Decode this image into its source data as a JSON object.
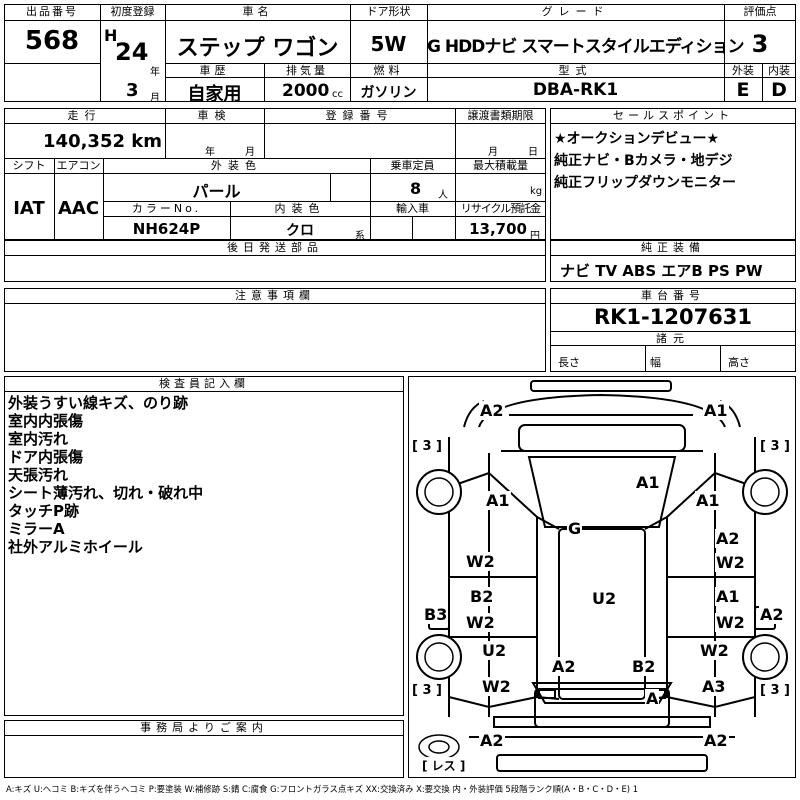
{
  "header": {
    "lot_label": "出品番号",
    "lot": "568",
    "first_reg_label": "初度登録",
    "era": "H",
    "year_num": "24",
    "year_unit": "年",
    "month_num": "3",
    "month_unit": "月",
    "name_label": "車名",
    "name": "ステップ ワゴン",
    "door_label": "ドア形状",
    "door": "5W",
    "grade_label": "グレード",
    "grade": "G HDDナビ スマートスタイルエディション",
    "score_label": "評価点",
    "score": "3",
    "history_label": "車歴",
    "history": "自家用",
    "displacement_label": "排気量",
    "displacement": "2000",
    "displacement_unit": "cc",
    "fuel_label": "燃料",
    "fuel": "ガソリン",
    "model_label": "型式",
    "model": "DBA-RK1",
    "ext_grade_label": "外装",
    "ext_grade": "E",
    "int_grade_label": "内装",
    "int_grade": "D"
  },
  "row2": {
    "mileage_label": "走行",
    "mileage": "140,352 km",
    "inspection_label": "車検",
    "year_unit": "年",
    "month_unit": "月",
    "plate_label": "登録番号",
    "transfer_label": "譲渡書類期限",
    "transfer_month": "月",
    "transfer_day": "日",
    "shift_label": "シフト",
    "shift": "IAT",
    "ac_label": "エアコン",
    "ac": "AAC",
    "exterior_label": "外装色",
    "exterior": "パール",
    "capacity_label": "乗車定員",
    "capacity": "8",
    "capacity_unit": "人",
    "load_label": "最大積載量",
    "load_unit": "kg",
    "color_no_label": "カラーNo.",
    "color_no": "NH624P",
    "interior_label": "内装色",
    "interior": "クロ",
    "interior_unit": "系",
    "import_label": "輸入車",
    "recycle_label": "リサイクル預託金",
    "recycle": "13,700",
    "recycle_unit": "円",
    "later_label": "後日発送部品"
  },
  "sales_point": {
    "label": "セールスポイント",
    "lines": [
      "★オークションデビュー★",
      "純正ナビ・Bカメラ・地デジ",
      "純正フリップダウンモニター"
    ]
  },
  "equipment": {
    "label": "純正装備",
    "value": "ナビ TV ABS エアB PS PW"
  },
  "caution": {
    "label": "注意事項欄"
  },
  "chassis": {
    "label": "車台番号",
    "value": "RK1-1207631",
    "spec_label": "諸元",
    "length_label": "長さ",
    "width_label": "幅",
    "height_label": "高さ"
  },
  "inspector": {
    "label": "検査員記入欄",
    "lines": [
      "外装うすい線キズ、のり跡",
      "室内内張傷",
      "室内汚れ",
      "ドア内張傷",
      "天張汚れ",
      "シート薄汚れ、切れ・破れ中",
      "タッチP跡",
      "ミラーA",
      "社外アルミホイール"
    ]
  },
  "office": {
    "label": "事務局よりご案内"
  },
  "diagram": {
    "tire_marks": [
      "[ 3 ]",
      "[ 3 ]",
      "[ 3 ]",
      "[ 3 ]"
    ],
    "spare_label": "[ レス ]",
    "marks": [
      {
        "id": "front-left-corner",
        "text": "A2"
      },
      {
        "id": "front-right-corner",
        "text": "A1"
      },
      {
        "id": "windshield",
        "text": "A1"
      },
      {
        "id": "left-front-fender",
        "text": "A1"
      },
      {
        "id": "right-front-fender",
        "text": "A1"
      },
      {
        "id": "glass",
        "text": "G"
      },
      {
        "id": "left-front-door",
        "text": "W2"
      },
      {
        "id": "right-front-door-a",
        "text": "A2"
      },
      {
        "id": "right-front-door-w",
        "text": "W2"
      },
      {
        "id": "left-rear-door-b",
        "text": "B2"
      },
      {
        "id": "left-rear-door-w",
        "text": "W2"
      },
      {
        "id": "roof",
        "text": "U2"
      },
      {
        "id": "right-rear-door-a",
        "text": "A1"
      },
      {
        "id": "right-rear-door-w",
        "text": "W2"
      },
      {
        "id": "left-sill",
        "text": "B3"
      },
      {
        "id": "right-sill",
        "text": "A2"
      },
      {
        "id": "left-quarter",
        "text": "U2"
      },
      {
        "id": "right-quarter",
        "text": "W2"
      },
      {
        "id": "rear-left",
        "text": "A2"
      },
      {
        "id": "rear-right",
        "text": "B2"
      },
      {
        "id": "left-rear-fender",
        "text": "W2"
      },
      {
        "id": "right-rear-fender",
        "text": "A3"
      },
      {
        "id": "rear-bumper",
        "text": "A"
      },
      {
        "id": "rear-left-corner",
        "text": "A2"
      },
      {
        "id": "rear-right-corner",
        "text": "A2"
      }
    ]
  },
  "legend": "A:キズ U:ヘコミ B:キズを伴うヘコミ P:要塗装 W:補修跡 S:錆 C:腐食 G:フロントガラス点キズ XX:交換済み X:要交換 内・外装評価 5段階ランク順(A・B・C・D・E) 1"
}
